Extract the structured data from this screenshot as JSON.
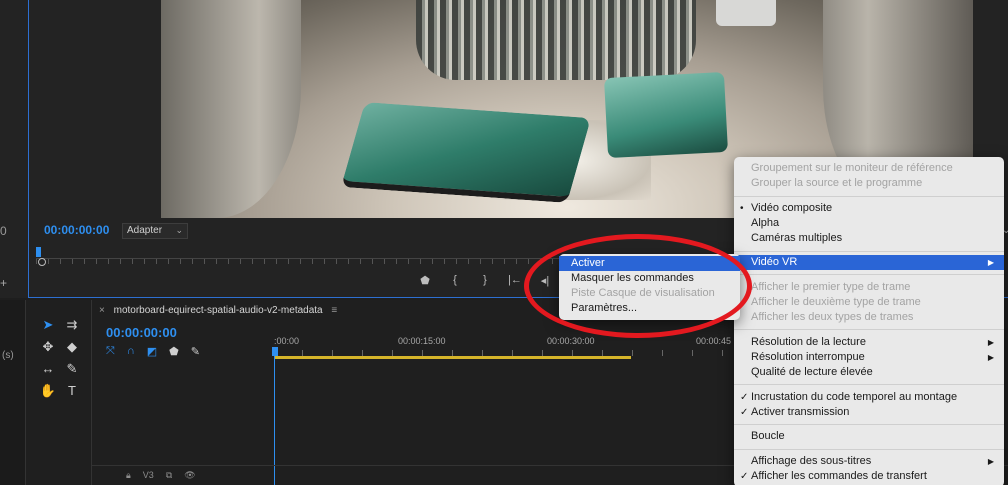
{
  "monitor": {
    "timecode": "00:00:00:00",
    "zoom_select": "Adapter",
    "left_edge_value": "0"
  },
  "sequence": {
    "tab_title": "motorboard-equirect-spatial-audio-v2-metadata",
    "timecode": "00:00:00:00",
    "ruler": [
      ":00:00",
      "00:00:15:00",
      "00:00:30:00",
      "00:00:45"
    ],
    "track_label": "V3",
    "left_panel_label": "(s)"
  },
  "submenu": {
    "items": [
      {
        "label": "Activer",
        "state": "highlight"
      },
      {
        "label": "Masquer les commandes",
        "state": "enabled"
      },
      {
        "label": "Piste Casque de visualisation",
        "state": "disabled"
      },
      {
        "label": "Paramètres...",
        "state": "enabled"
      }
    ]
  },
  "menu": {
    "group_ref_1": "Groupement sur le moniteur de référence",
    "group_ref_2": "Grouper la source et le programme",
    "composite": "Vidéo composite",
    "alpha": "Alpha",
    "multi_cam": "Caméras multiples",
    "vr": "Vidéo VR",
    "field_1": "Afficher le premier type de trame",
    "field_2": "Afficher le deuxième type de trame",
    "field_both": "Afficher les deux types de trames",
    "playback_res": "Résolution de la lecture",
    "paused_res": "Résolution interrompue",
    "high_quality": "Qualité de lecture élevée",
    "timecode_overlay": "Incrustation du code temporel au montage",
    "transmit": "Activer transmission",
    "loop": "Boucle",
    "captions": "Affichage des sous-titres",
    "transport_controls": "Afficher les commandes de transfert"
  },
  "colors": {
    "accent": "#2e8ff0",
    "menu_highlight": "#2a65d6",
    "annotation": "#e3191f"
  }
}
